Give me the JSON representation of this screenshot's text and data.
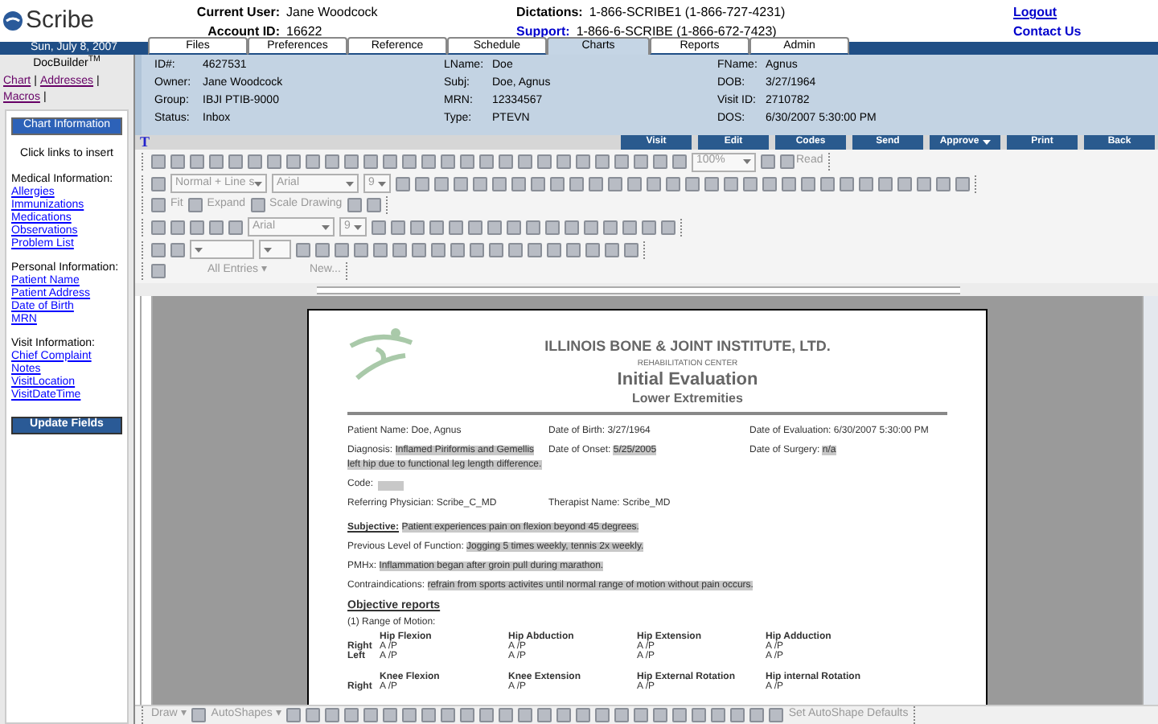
{
  "header": {
    "logo": "Scribe",
    "user_label": "Current User:",
    "user": "Jane Woodcock",
    "account_label": "Account ID:",
    "account": "16622",
    "dictations_label": "Dictations:",
    "dictations": "1-866-SCRIBE1 (1-866-727-4231)",
    "support_label": "Support:",
    "support": "1-866-6-SCRIBE (1-866-672-7423)",
    "links": [
      "Logout",
      "Contact Us"
    ]
  },
  "date": "Sun, July 8, 2007",
  "tabs": [
    {
      "label": "Files",
      "selected": false
    },
    {
      "label": "Preferences",
      "selected": false
    },
    {
      "label": "Reference",
      "selected": false
    },
    {
      "label": "Schedule",
      "selected": false
    },
    {
      "label": "Charts",
      "selected": true
    },
    {
      "label": "Reports",
      "selected": false
    },
    {
      "label": "Admin",
      "selected": false
    }
  ],
  "sidebar": {
    "title": "DocBuilder",
    "title_mark": "TM",
    "links": [
      "Chart",
      "Addresses",
      "Macros"
    ],
    "separator": "|",
    "panel_button": "Chart Information",
    "hint": "Click links to insert",
    "groups": [
      {
        "heading": "Medical Information:",
        "items": [
          "Allergies",
          "Immunizations",
          "Medications",
          "Observations",
          "Problem List"
        ]
      },
      {
        "heading": "Personal Information:",
        "items": [
          "Patient Name",
          "Patient Address",
          "Date of Birth",
          "MRN"
        ]
      },
      {
        "heading": "Visit Information:",
        "items": [
          "Chief Complaint",
          "Notes",
          "VisitLocation",
          "VisitDateTime"
        ]
      }
    ],
    "update_button": "Update Fields"
  },
  "chart_info": [
    [
      {
        "label": "ID#:",
        "value": "4627531"
      },
      {
        "label": "Owner:",
        "value": "Jane Woodcock"
      },
      {
        "label": "Group:",
        "value": "IBJI PTIB-9000"
      },
      {
        "label": "Status:",
        "value": "Inbox"
      }
    ],
    [
      {
        "label": "LName:",
        "value": "Doe"
      },
      {
        "label": "Subj:",
        "value": "Doe, Agnus"
      },
      {
        "label": "MRN:",
        "value": "12334567"
      },
      {
        "label": "Type:",
        "value": "PTEVN"
      }
    ],
    [
      {
        "label": "FName:",
        "value": "Agnus"
      },
      {
        "label": "DOB:",
        "value": "3/27/1964"
      },
      {
        "label": "Visit ID:",
        "value": "2710782"
      },
      {
        "label": "DOS:",
        "value": "6/30/2007 5:30:00 PM"
      }
    ]
  ],
  "editor_mark": "T",
  "actions": [
    {
      "label": "Visit",
      "menu": false
    },
    {
      "label": "Edit",
      "menu": false
    },
    {
      "label": "Codes",
      "menu": false
    },
    {
      "label": "Send",
      "menu": false
    },
    {
      "label": "Approve",
      "menu": true
    },
    {
      "label": "Print",
      "menu": false
    },
    {
      "label": "Back",
      "menu": false
    }
  ],
  "toolbar": {
    "zoom": "100%",
    "read": "Read",
    "style": "Normal + Line s",
    "font": "Arial",
    "size": "9",
    "fit": "Fit",
    "expand": "Expand",
    "scale": "Scale Drawing",
    "font2": "Arial",
    "size2": "9",
    "entries": "All Entries ▾",
    "new": "New...",
    "draw": "Draw ▾",
    "autoshapes": "AutoShapes ▾",
    "defaults": "Set AutoShape Defaults"
  },
  "document": {
    "org": "ILLINOIS BONE & JOINT INSTITUTE, LTD.",
    "dept": "REHABILITATION CENTER",
    "title": "Initial Evaluation",
    "subtitle": "Lower Extremities",
    "fields": [
      [
        {
          "label": "Patient Name:",
          "value": "Doe, Agnus",
          "filled": false
        },
        {
          "label": "Date of Birth:",
          "value": "3/27/1964",
          "filled": false
        },
        {
          "label": "Date of Evaluation:",
          "value": "6/30/2007 5:30:00 PM",
          "filled": false
        }
      ],
      [
        {
          "label": "Diagnosis:",
          "value": "Inflamed Piriformis and Gemellis left hip due to functional leg length difference.",
          "filled": true
        },
        {
          "label": "Date of Onset:",
          "value": "5/25/2005",
          "filled": true
        },
        {
          "label": "Date of Surgery:",
          "value": "n/a",
          "filled": true
        }
      ]
    ],
    "code_label": "Code:",
    "physicians": [
      {
        "label": "Referring Physician:",
        "value": "Scribe_C_MD"
      },
      {
        "label": "Therapist Name:",
        "value": "Scribe_MD"
      }
    ],
    "notes": [
      {
        "label": "Subjective:",
        "value": "Patient experiences pain on flexion beyond 45 degrees.",
        "underline": true
      },
      {
        "label": "Previous Level of Function:",
        "value": "Jogging 5 times weekly, tennis 2x weekly.",
        "underline": false
      },
      {
        "label": "PMHx:",
        "value": "Inflammation began after groin pull during marathon.",
        "underline": false
      },
      {
        "label": "Contraindications:",
        "value": "refrain from sports activites until normal range of motion without pain occurs.",
        "underline": false
      }
    ],
    "objective": "Objective reports",
    "rom": "(1)  Range of Motion:",
    "rom_groups": [
      {
        "columns": [
          "Hip Flexion",
          "Hip Abduction",
          "Hip Extension",
          "Hip Adduction"
        ],
        "rows": [
          {
            "side": "Right",
            "values": [
              "A  /P",
              "A  /P",
              "A  /P",
              "A  /P"
            ]
          },
          {
            "side": "Left",
            "values": [
              "A  /P",
              "A  /P",
              "A  /P",
              "A  /P"
            ]
          }
        ]
      },
      {
        "columns": [
          "Knee Flexion",
          "Knee Extension",
          "Hip External Rotation",
          "Hip internal Rotation"
        ],
        "rows": [
          {
            "side": "Right",
            "values": [
              "A  /P",
              "A  /P",
              "A  /P",
              "A  /P"
            ]
          }
        ]
      }
    ]
  }
}
